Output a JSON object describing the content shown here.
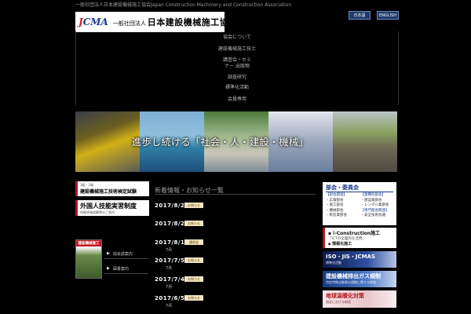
{
  "header": {
    "tagline": "一般社団法人日本建設機械施工協会Japan Construction Machinery and Construction Association",
    "logo_mark_j": "J",
    "logo_mark_rest": "CMA",
    "logo_prefix": "一般社団法人",
    "logo_name": "日本建設機械施工協会",
    "lang_buttons": [
      "日本語",
      "ENGLISH"
    ]
  },
  "menu": {
    "items": [
      "協会について",
      "建設機械施工技士",
      "講習会・セミナー 出版物",
      "調査研究",
      "標準化活動",
      "会員専用"
    ]
  },
  "hero": {
    "caption": "進歩し続ける「社会・人・建設・機械」"
  },
  "left_banners": {
    "exam_sub": "1級・2級",
    "exam_main": "建設機械施工技術検定試験",
    "foreign_main": "外国人技能実習制度",
    "foreign_sub": "技能評価試験等のご案内"
  },
  "book": {
    "title": "建設機械施工"
  },
  "side_links": [
    "協会誌案内",
    "図書案内"
  ],
  "news": {
    "title": "新着情報・お知らせ一覧",
    "items": [
      {
        "date": "2017/8/2",
        "badge": "お知らせ",
        "text": ""
      },
      {
        "date": "2017/8/2",
        "badge": "お知らせ",
        "text": ""
      },
      {
        "date": "2017/8/1",
        "badge": "講習会",
        "text": "7月"
      },
      {
        "date": "2017/7/5",
        "badge": "お知らせ",
        "text": "7月"
      },
      {
        "date": "2017/7/4",
        "badge": "お知らせ",
        "text": "7月"
      },
      {
        "date": "2017/6/5",
        "badge": "お知らせ",
        "text": "7月"
      }
    ]
  },
  "committees": {
    "title": "部会・委員会",
    "col1": [
      {
        "kind": "h",
        "label": "【部会関連】"
      },
      {
        "kind": "i",
        "label": "広報部会"
      },
      {
        "kind": "i",
        "label": "施工部会"
      },
      {
        "kind": "i",
        "label": "機械部会"
      },
      {
        "kind": "i",
        "label": "製造業部会"
      }
    ],
    "col2": [
      {
        "kind": "h",
        "label": "【業種別部会】"
      },
      {
        "kind": "i",
        "label": "建設業部会"
      },
      {
        "kind": "i",
        "label": "レンタル業部会"
      },
      {
        "kind": "h",
        "label": "【専門部会関連】"
      },
      {
        "kind": "i",
        "label": "安全技術会議"
      }
    ]
  },
  "right_cards": {
    "ic_title": "▪ i-Construction施工",
    "ic_sub": "「ICTの全面的な活用」",
    "ic_extra": "▪ 情報化施工",
    "iso_title": "ISO・JIS・JCMAS",
    "iso_sub": "標準化活動",
    "emis_title": "建設機械排出ガス規制",
    "emis_sub": "特定特殊自動車の規制に関する情報",
    "warm_title": "地球温暖化対策",
    "warm_sub": "協会における取組"
  }
}
